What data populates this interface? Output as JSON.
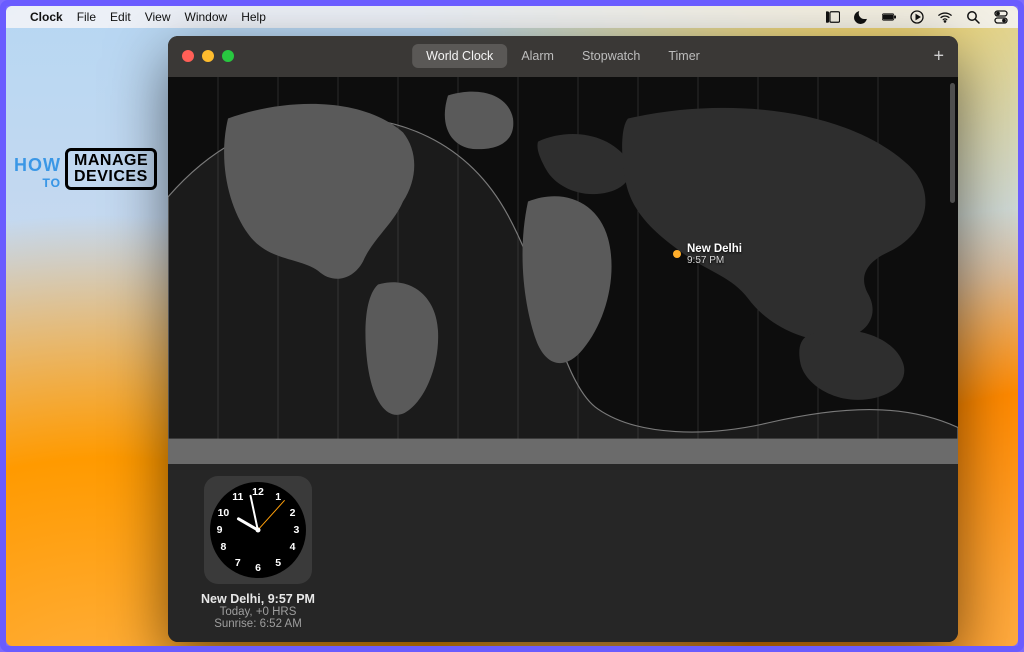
{
  "menubar": {
    "app": "Clock",
    "items": [
      "File",
      "Edit",
      "View",
      "Window",
      "Help"
    ]
  },
  "window": {
    "tabs": [
      "World Clock",
      "Alarm",
      "Stopwatch",
      "Timer"
    ],
    "active_tab": "World Clock",
    "add_label": "+"
  },
  "map": {
    "city": {
      "name": "New Delhi",
      "time": "9:57 PM"
    }
  },
  "card": {
    "title": "New Delhi, 9:57 PM",
    "line2": "Today, +0 HRS",
    "line3": "Sunrise: 6:52 AM"
  },
  "watermark": {
    "how": "HOW",
    "to": "TO",
    "line1": "MANAGE",
    "line2": "DEVICES"
  }
}
